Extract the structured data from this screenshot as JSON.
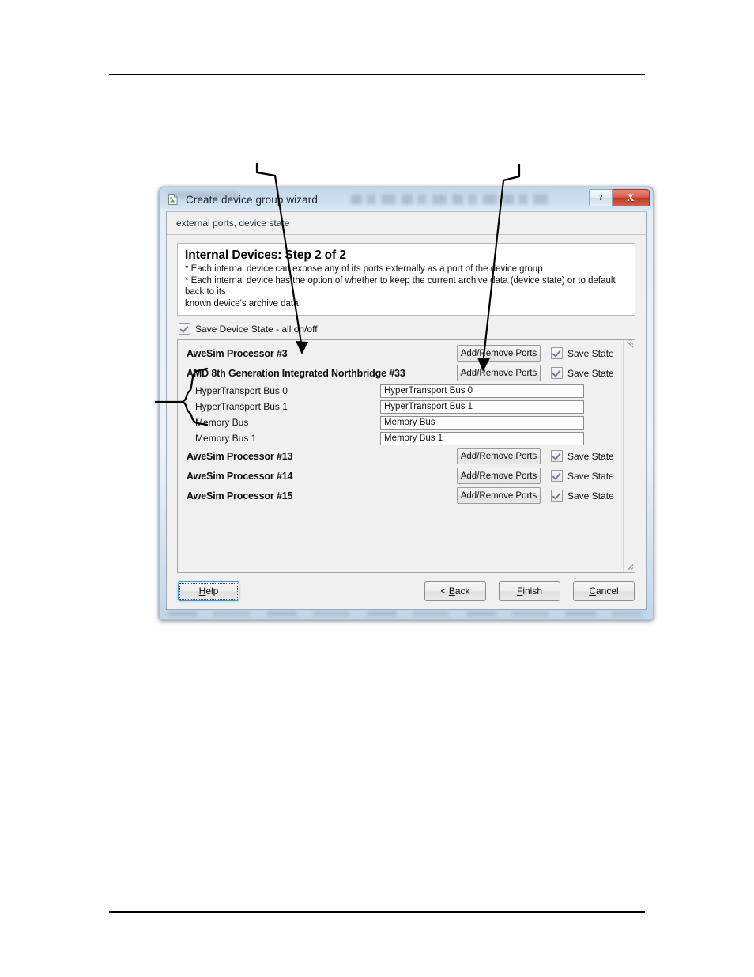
{
  "window": {
    "title": "Create device group wizard",
    "icon": "document-wizard-icon",
    "caption_buttons": {
      "help": "?",
      "close": "X"
    }
  },
  "subheader": {
    "text": "external ports, device state"
  },
  "info_panel": {
    "title": "Internal Devices: Step 2 of 2",
    "line1": "* Each internal device can expose any of its ports externally as a port of the device group",
    "line2": "* Each internal device has the option of whether to keep the current archive data (device state) or to default back to its",
    "line3": "known device's archive data"
  },
  "master_checkbox": {
    "label": "Save Device State - all on/off",
    "checked": true
  },
  "labels": {
    "add_remove_ports": "Add/Remove Ports",
    "save_state": "Save State"
  },
  "devices": [
    {
      "name": "AweSim Processor #3",
      "button": "Add/Remove Ports",
      "save_state_label": "Save State",
      "save_state_checked": true,
      "ports": []
    },
    {
      "name": "AMD 8th Generation Integrated Northbridge #33",
      "button": "Add/Remove Ports",
      "save_state_label": "Save State",
      "save_state_checked": true,
      "ports": [
        {
          "label": "HyperTransport Bus 0",
          "value": "HyperTransport Bus 0"
        },
        {
          "label": "HyperTransport Bus 1",
          "value": "HyperTransport Bus 1"
        },
        {
          "label": "Memory Bus",
          "value": "Memory Bus"
        },
        {
          "label": "Memory Bus 1",
          "value": "Memory Bus 1"
        }
      ]
    },
    {
      "name": "AweSim Processor #13",
      "button": "Add/Remove Ports",
      "save_state_label": "Save State",
      "save_state_checked": true,
      "ports": []
    },
    {
      "name": "AweSim Processor #14",
      "button": "Add/Remove Ports",
      "save_state_label": "Save State",
      "save_state_checked": true,
      "ports": []
    },
    {
      "name": "AweSim Processor #15",
      "button": "Add/Remove Ports",
      "save_state_label": "Save State",
      "save_state_checked": true,
      "ports": []
    }
  ],
  "footer": {
    "help": "Help",
    "help_accel": "H",
    "back": "< Back",
    "back_accel": "B",
    "finish": "Finish",
    "finish_accel": "F",
    "cancel": "Cancel",
    "cancel_accel": "C"
  },
  "colors": {
    "titlebar_glass": "#cfe0f0",
    "close_button": "#c03f2a",
    "checkmark": "#6a82a6",
    "subheader_text": "#1b2b45",
    "page_rule": "#000000"
  }
}
